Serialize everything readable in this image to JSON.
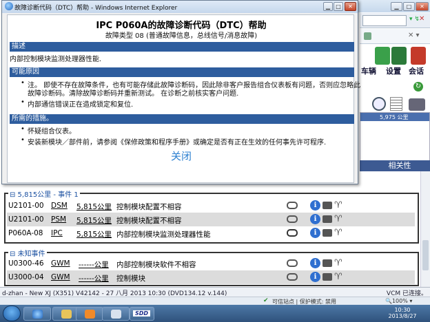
{
  "popup": {
    "window_title": "故障诊断代码（DTC）帮助 - Windows Internet Explorer",
    "title": "IPC P060A的故障诊断代码（DTC）帮助",
    "subtitle": "故障类型 08 (普通故障信息，总线信号/消息故障)",
    "sections": {
      "description_header": "描述",
      "description_text": "内部控制模块监测处理器性能.",
      "causes_header": "可能原因",
      "cause_1_line1": "注。  即使不存在故障条件，也有可能存储此故障诊断码，因此除非客户报告组合仪表板有问题，否则应忽略此",
      "cause_1_line2": "故障诊断码。清除故障诊断码并重新测试。  在诊断之前核实客户问题.",
      "cause_2": "内部通信错误正在造成锁定和复位.",
      "actions_header": "所需的措施。",
      "action_1": "怀疑组合仪表。",
      "action_2": "安装新模块／部件前，请参阅《保修政策和程序手册》或确定是否有正在生效的任何事先许可程序."
    },
    "close_label": "关闭"
  },
  "background": {
    "nav_vehicle": "车辆",
    "nav_settings": "设置",
    "nav_session": "会话",
    "odometer_reading": "5,975 公里",
    "related_label": "相关性",
    "address_arrow": "▾ ↯",
    "address_close": "✕",
    "tab_close": "✕ ▾"
  },
  "groups": [
    {
      "legend": "⊟ 5,815公里 - 事件 1",
      "rows": [
        {
          "code": "U2101-00",
          "module": "DSM",
          "mileage": "5,815公里",
          "desc": "控制模块配置不相容"
        },
        {
          "code": "U2101-00",
          "module": "PSM",
          "mileage": "5,815公里",
          "desc": "控制模块配置不相容"
        },
        {
          "code": "P060A-08",
          "module": "IPC",
          "mileage": "5,815公里",
          "desc": "内部控制模块监测处理器性能"
        }
      ]
    },
    {
      "legend": "⊟ 未知事件",
      "rows": [
        {
          "code": "U0300-46",
          "module": "GWM",
          "mileage": "------公里",
          "desc": "内部控制模块软件不相容"
        },
        {
          "code": "U3000-04",
          "module": "GWM",
          "mileage": "------公里",
          "desc": "控制模块"
        }
      ]
    }
  ],
  "status": {
    "left": "d-zhan - New XJ (X351) V42142 - 27 八月 2013 10:30 (DVD134.12 v.144)",
    "right": "VCM 已连接。",
    "ie_trust": "可信站点 | 保护模式: 禁用",
    "ie_zoom": "🔍100%  ▾"
  },
  "taskbar": {
    "sdd_label": "SDD",
    "time": "10:30",
    "date": "2013/8/27"
  },
  "colors": {
    "section_header": "#2e5d9e",
    "close_link": "#2b7fd0",
    "taskbar": "#3a608c"
  }
}
